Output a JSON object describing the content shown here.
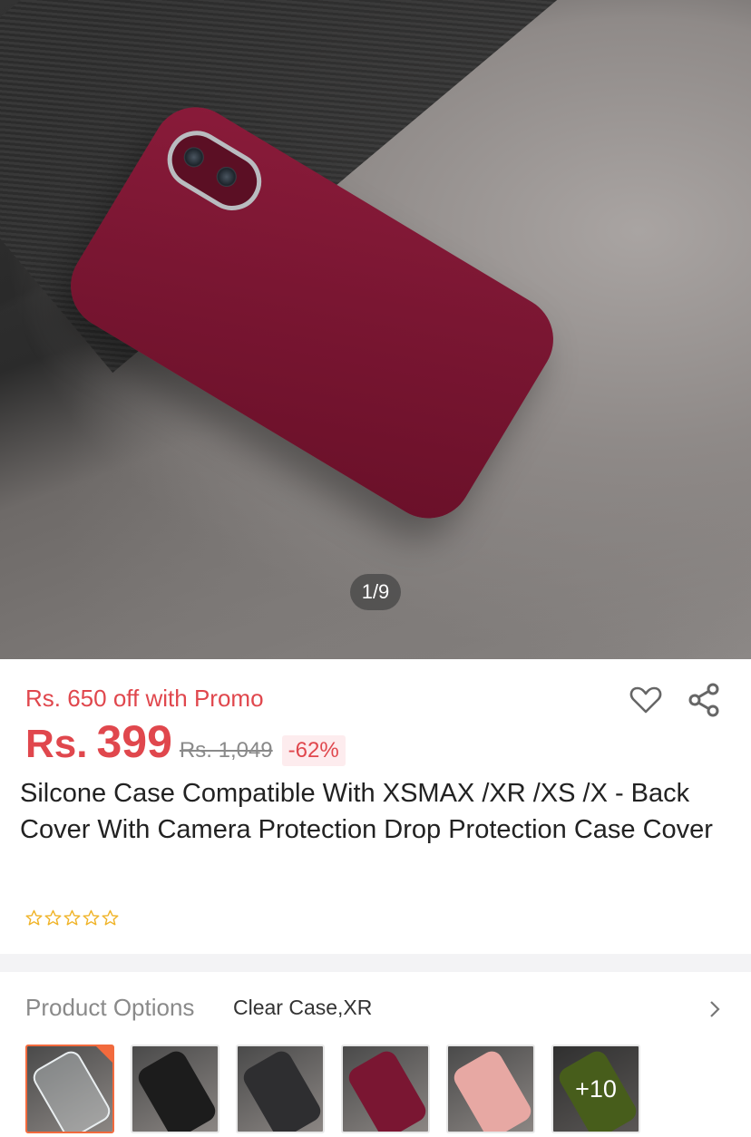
{
  "gallery": {
    "counter": "1/9"
  },
  "pricing": {
    "promo": "Rs. 650 off with Promo",
    "currency": "Rs.",
    "price": "399",
    "old_price": "Rs. 1,049",
    "discount": "-62%"
  },
  "product": {
    "title": "Silcone Case Compatible With XSMAX /XR /XS /X - Back Cover With Camera Protection Drop Protection Case Cover",
    "rating": 0,
    "rating_max": 5
  },
  "icons": {
    "wishlist": "heart-icon",
    "share": "share-icon",
    "chevron": "chevron-right-icon",
    "star": "star-outline-icon"
  },
  "options": {
    "header": "Product Options",
    "selected": "Clear Case,XR",
    "more_label": "+10",
    "swatches": [
      {
        "name": "clear",
        "color": "#cfd6da"
      },
      {
        "name": "black",
        "color": "#1c1c1c"
      },
      {
        "name": "dark-grey",
        "color": "#2e2e30"
      },
      {
        "name": "maroon",
        "color": "#7a1632"
      },
      {
        "name": "pink",
        "color": "#e7a8a3"
      },
      {
        "name": "green",
        "color": "#6e8f2a"
      }
    ]
  },
  "colors": {
    "accent": "#e0474d",
    "selected_border": "#f26a3d",
    "star": "#f0b429"
  }
}
